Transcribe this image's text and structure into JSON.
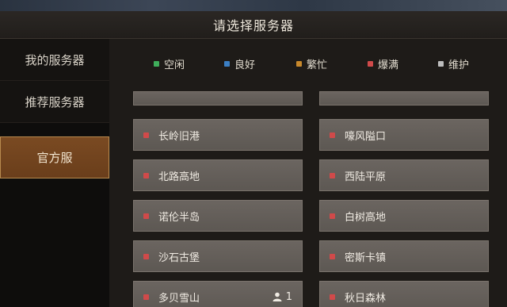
{
  "title": "请选择服务器",
  "sidebar": {
    "tabs": [
      {
        "label": "我的服务器",
        "active": false
      },
      {
        "label": "推荐服务器",
        "active": false
      },
      {
        "label": "官方服",
        "active": true
      }
    ]
  },
  "legend": [
    {
      "label": "空闲",
      "color": "#3fae5b"
    },
    {
      "label": "良好",
      "color": "#3b7fc4"
    },
    {
      "label": "繁忙",
      "color": "#c8892c"
    },
    {
      "label": "爆满",
      "color": "#d04a4a"
    },
    {
      "label": "维护",
      "color": "#bdbdbd"
    }
  ],
  "status_color": "#d04a4a",
  "servers": {
    "left": [
      {
        "name": "长岭旧港",
        "players": ""
      },
      {
        "name": "北路高地",
        "players": ""
      },
      {
        "name": "诺伦半岛",
        "players": ""
      },
      {
        "name": "沙石古堡",
        "players": ""
      },
      {
        "name": "多贝雪山",
        "players": "1"
      }
    ],
    "right": [
      {
        "name": "嚎风隘口",
        "players": ""
      },
      {
        "name": "西陆平原",
        "players": ""
      },
      {
        "name": "白树高地",
        "players": ""
      },
      {
        "name": "密斯卡镇",
        "players": ""
      },
      {
        "name": "秋日森林",
        "players": ""
      }
    ]
  }
}
